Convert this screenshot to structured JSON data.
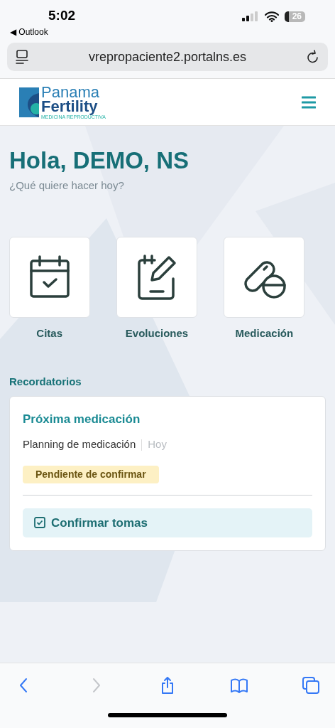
{
  "status_bar": {
    "time": "5:02",
    "back_app": "◀ Outlook",
    "battery": "26"
  },
  "browser": {
    "url": "vrepropaciente2.portalns.es"
  },
  "logo": {
    "line1": "Panama",
    "line2": "Fertility",
    "tagline": "MEDICINA REPRODUCTIVA"
  },
  "greeting": {
    "title": "Hola, DEMO, NS",
    "subtitle": "¿Qué quiere hacer hoy?"
  },
  "shortcuts": [
    {
      "kind": "calendar",
      "label": "Citas"
    },
    {
      "kind": "notes",
      "label": "Evoluciones"
    },
    {
      "kind": "pills",
      "label": "Medicación"
    }
  ],
  "reminders": {
    "heading": "Recordatorios",
    "card": {
      "title": "Próxima medicación",
      "item": "Planning de medicación",
      "when": "Hoy",
      "status": "Pendiente de confirmar",
      "action": "Confirmar tomas"
    }
  },
  "toolbar": [
    {
      "kind": "back",
      "disabled": false
    },
    {
      "kind": "forward",
      "disabled": true
    },
    {
      "kind": "share",
      "disabled": false
    },
    {
      "kind": "bookmarks",
      "disabled": false
    },
    {
      "kind": "tabs",
      "disabled": false
    }
  ]
}
